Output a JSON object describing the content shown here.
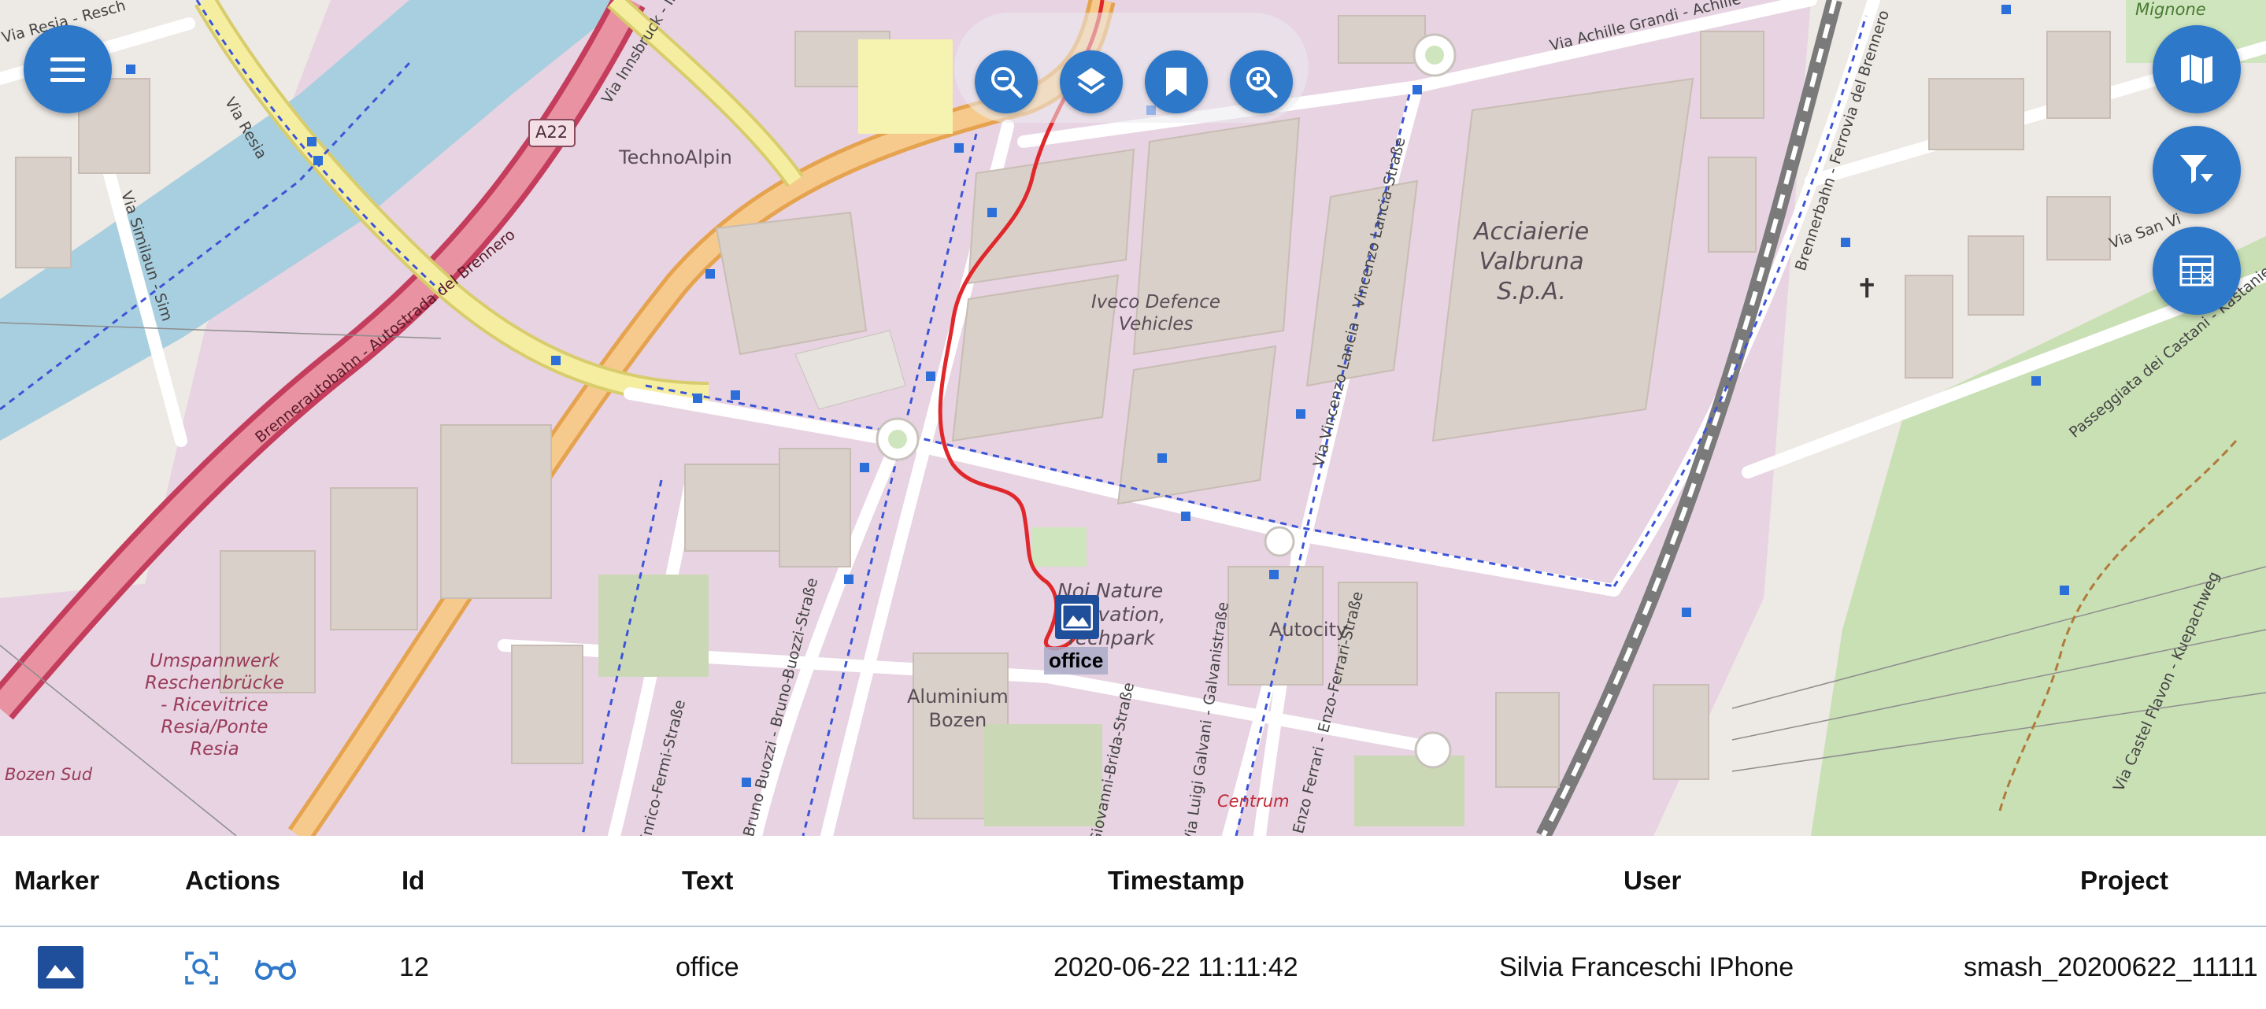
{
  "map": {
    "labels": {
      "technoalpin": "TechnoAlpin",
      "acciaierie": [
        "Acciaierie",
        "Valbruna",
        "S.p.A."
      ],
      "iveco": [
        "Iveco Defence",
        "Vehicles"
      ],
      "noi": [
        "Noi Nature",
        "Innovation,",
        "Techpark"
      ],
      "autocity": "Autocity",
      "aluminium": [
        "Aluminium",
        "Bozen"
      ],
      "umspannwerk": [
        "Umspannwerk",
        "Reschenbrücke",
        "- Ricevitrice",
        "Resia/Ponte",
        "Resia"
      ],
      "bozen_sud": "Bozen Sud",
      "centrum": "Centrum",
      "mignone": "Mignone"
    },
    "roads": {
      "a22": "A22",
      "brennerautobahn": "Brennerautobahn - Autostrada del Brennero",
      "via_innsbruck": "Via Innsbruck - Innsbrucker",
      "via_resia_top": "Via Resia - Resch",
      "via_resia": "Via Resia",
      "via_similaun": "Via Similaun - Sim",
      "via_achille": "Via Achille Grandi - Achille",
      "via_lancia": "Via Vincenzo Lancia - Vincenzo Lancia-Straße",
      "brennerbahn": "Brennerbahn - Ferrovia del Brennero",
      "via_san_vi": "Via San Vi",
      "passeggiata": "Passeggiata dei Castani - Kastanienweg",
      "via_castel": "Via Castel Flavon - Kuepachweg",
      "buozzi": "Bruno Buozzi - Bruno-Buozzi-Straße",
      "fermi": "Enrico-Fermi-Straße",
      "galvani": "Via Luigi Galvani - Galvanistraße",
      "ferrari": "Enzo Ferrari - Enzo-Ferrari-Straße",
      "brida": "Giovanni-Brida-Straße"
    },
    "marker": {
      "label": "office",
      "icon": "image-icon"
    },
    "buttons": {
      "menu": "menu-icon",
      "zoom_out": "zoom-out-icon",
      "layers": "layers-icon",
      "bookmark": "bookmark-icon",
      "zoom_in": "zoom-in-icon",
      "map": "map-icon",
      "filter": "filter-icon",
      "table": "table-icon"
    },
    "colors": {
      "fab": "#2e78c9",
      "track": "#e0282c",
      "marker": "#1f4e9a"
    }
  },
  "table": {
    "headers": [
      "Marker",
      "Actions",
      "Id",
      "Text",
      "Timestamp",
      "User",
      "Project"
    ],
    "rows": [
      {
        "marker_icon": "image-icon",
        "actions": [
          "zoom-to-icon",
          "view-icon"
        ],
        "id": "12",
        "text": "office",
        "timestamp": "2020-06-22 11:11:42",
        "user": "Silvia Franceschi IPhone",
        "project": "smash_20200622_11111"
      }
    ]
  }
}
